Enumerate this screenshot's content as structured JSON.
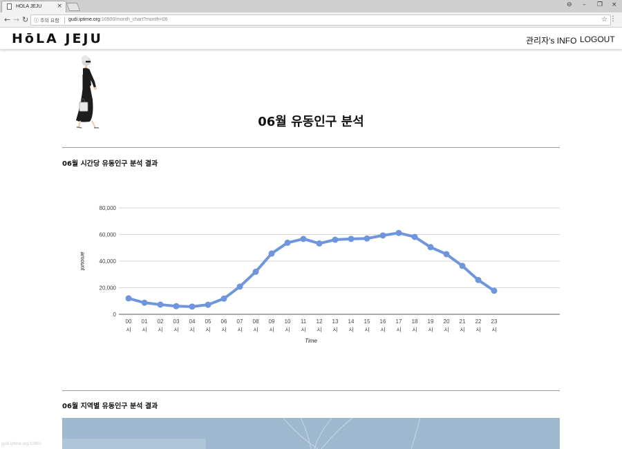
{
  "browser": {
    "tab_title": "HOLA JEJU",
    "tab_close": "×",
    "security_label": "주의 요함",
    "url_host": "gudi.iptime.org",
    "url_rest": ":10900/month_chart?month=06",
    "window_controls": [
      "⊖",
      "–",
      "❐",
      "×"
    ]
  },
  "header": {
    "logo": "HōLA JEJU",
    "admin_info": "관리자's INFO",
    "logout": "LOGOUT"
  },
  "page": {
    "title": "06월 유동인구 분석",
    "section1_title": "06월 시간당 유동인구 분석 결과",
    "section2_title": "06월 지역별 유동인구 분석 결과"
  },
  "status_text": "gudi.iptime.org:10900",
  "chart_data": {
    "type": "line",
    "xlabel": "Time",
    "ylabel": "amount",
    "ylim": [
      0,
      80000
    ],
    "yticks": [
      "0",
      "20,000",
      "40,000",
      "60,000",
      "80,000"
    ],
    "categories": [
      "00",
      "01",
      "02",
      "03",
      "04",
      "05",
      "06",
      "07",
      "08",
      "09",
      "10",
      "11",
      "12",
      "13",
      "14",
      "15",
      "16",
      "17",
      "18",
      "19",
      "20",
      "21",
      "22",
      "23"
    ],
    "category_suffix": "시",
    "series": [
      {
        "values": [
          12000,
          8700,
          7300,
          6100,
          5800,
          7200,
          11800,
          20800,
          32000,
          45700,
          53800,
          56700,
          53300,
          56100,
          56700,
          57000,
          59300,
          61200,
          58200,
          50500,
          45200,
          36400,
          25800,
          17700
        ],
        "color": "#6f95dc"
      }
    ],
    "grid": true
  },
  "colors": {
    "accent_line": "#6f95dc",
    "map_water": "#9db8cf",
    "divider": "#9a9a9a"
  }
}
